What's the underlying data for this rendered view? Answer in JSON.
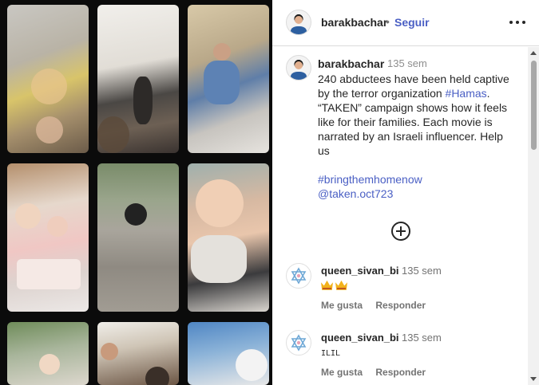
{
  "header": {
    "username": "barakbachar",
    "separator": "•",
    "follow_label": "Seguir",
    "more_icon": "more-horizontal-icon"
  },
  "caption": {
    "username": "barakbachar",
    "time": "135 sem",
    "text_before_tag": "240 abductees have been held captive by the terror organization ",
    "tag": "#Hamas",
    "text_after_tag": ". “TAKEN” campaign shows how it feels like for their families. Each movie is narrated by an Israeli influencer.  Help us",
    "hashtag": "#bringthemhomenow",
    "mention": "@taken.oct723"
  },
  "load_more_icon": "plus-circle-icon",
  "comments": [
    {
      "username": "queen_sivan_bi",
      "time": "135 sem",
      "text": "",
      "emoji_icons": [
        "crown-icon",
        "crown-icon"
      ],
      "like_label": "Me gusta",
      "reply_label": "Responder"
    },
    {
      "username": "queen_sivan_bi",
      "time": "135 sem",
      "text": "ILIL",
      "like_label": "Me gusta",
      "reply_label": "Responder"
    }
  ],
  "colors": {
    "link": "#4a5fc4",
    "text": "#262626",
    "muted": "#737373",
    "media_background": "#0b0b0b"
  }
}
